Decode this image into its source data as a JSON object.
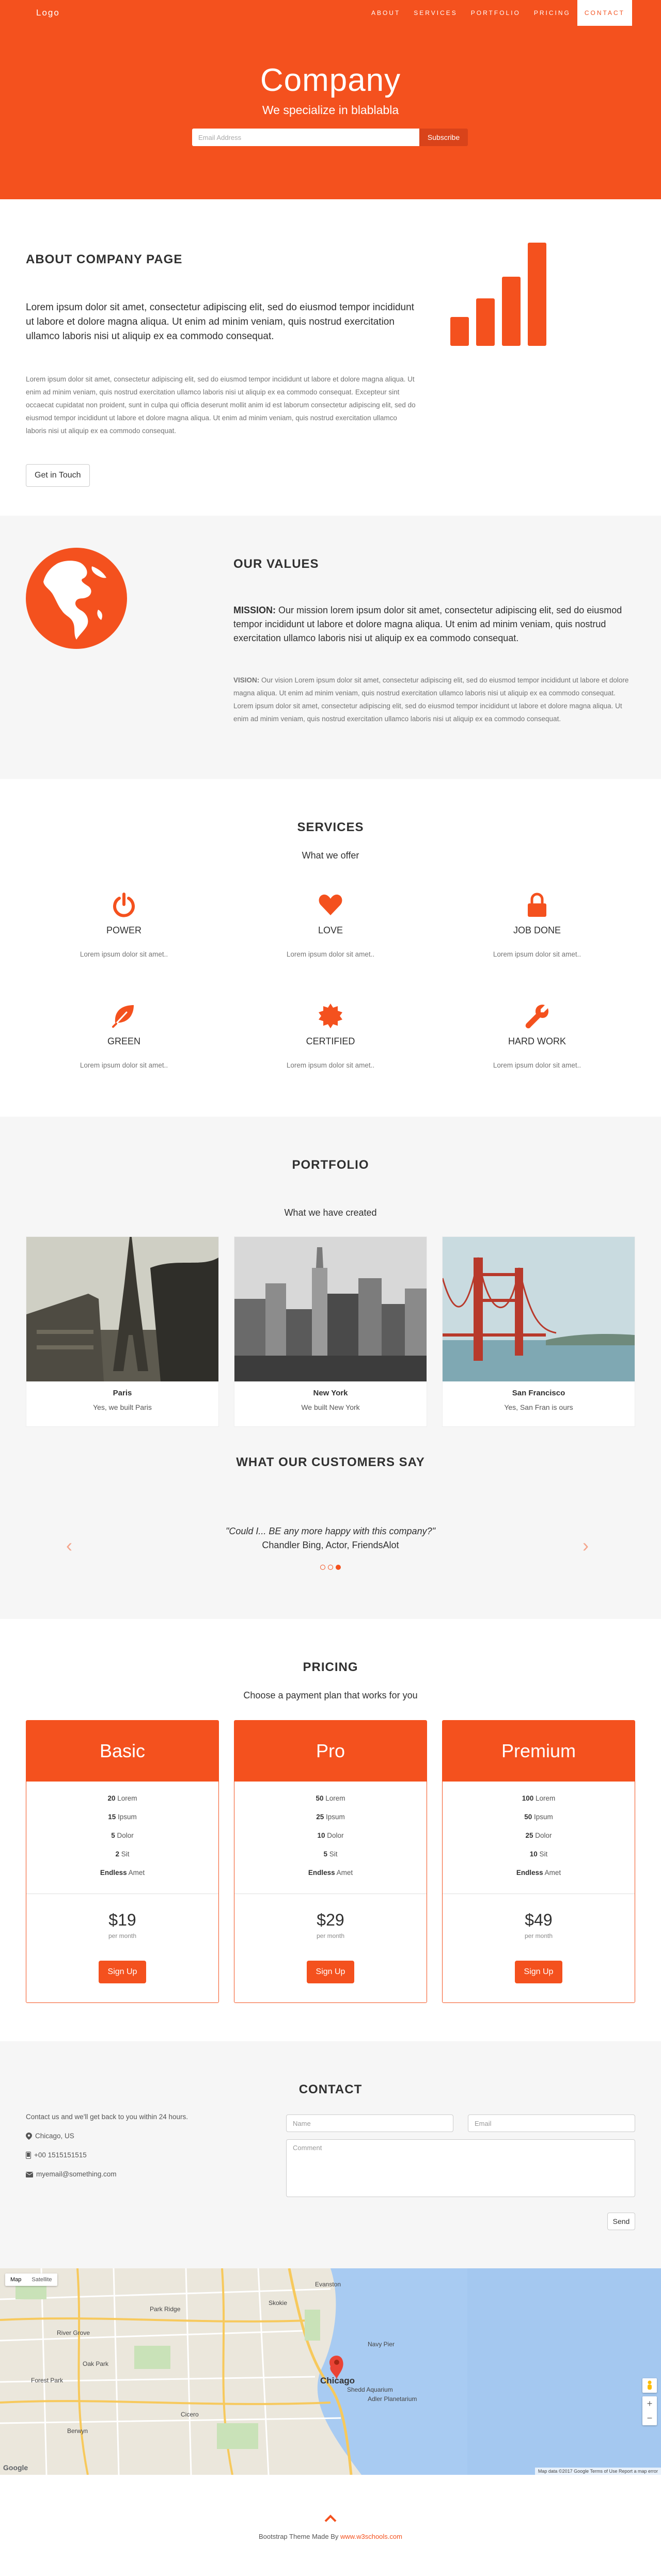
{
  "nav": {
    "logo": "Logo",
    "links": [
      "ABOUT",
      "SERVICES",
      "PORTFOLIO",
      "PRICING",
      "CONTACT"
    ]
  },
  "hero": {
    "title": "Company",
    "subtitle": "We specialize in blablabla",
    "email_placeholder": "Email Address",
    "subscribe_label": "Subscribe"
  },
  "about": {
    "title": "ABOUT COMPANY PAGE",
    "lead": "Lorem ipsum dolor sit amet, consectetur adipiscing elit, sed do eiusmod tempor incididunt ut labore et dolore magna aliqua. Ut enim ad minim veniam, quis nostrud exercitation ullamco laboris nisi ut aliquip ex ea commodo consequat.",
    "body": "Lorem ipsum dolor sit amet, consectetur adipiscing elit, sed do eiusmod tempor incididunt ut labore et dolore magna aliqua. Ut enim ad minim veniam, quis nostrud exercitation ullamco laboris nisi ut aliquip ex ea commodo consequat. Excepteur sint occaecat cupidatat non proident, sunt in culpa qui officia deserunt mollit anim id est laborum consectetur adipiscing elit, sed do eiusmod tempor incididunt ut labore et dolore magna aliqua. Ut enim ad minim veniam, quis nostrud exercitation ullamco laboris nisi ut aliquip ex ea commodo consequat.",
    "button": "Get in Touch",
    "icon": "signal-icon"
  },
  "values": {
    "title": "OUR VALUES",
    "mission_label": "MISSION:",
    "mission": " Our mission lorem ipsum dolor sit amet, consectetur adipiscing elit, sed do eiusmod tempor incididunt ut labore et dolore magna aliqua. Ut enim ad minim veniam, quis nostrud exercitation ullamco laboris nisi ut aliquip ex ea commodo consequat.",
    "vision_label": "VISION:",
    "vision": " Our vision Lorem ipsum dolor sit amet, consectetur adipiscing elit, sed do eiusmod tempor incididunt ut labore et dolore magna aliqua. Ut enim ad minim veniam, quis nostrud exercitation ullamco laboris nisi ut aliquip ex ea commodo consequat. Lorem ipsum dolor sit amet, consectetur adipiscing elit, sed do eiusmod tempor incididunt ut labore et dolore magna aliqua. Ut enim ad minim veniam, quis nostrud exercitation ullamco laboris nisi ut aliquip ex ea commodo consequat.",
    "icon": "globe-icon"
  },
  "services": {
    "title": "SERVICES",
    "subtitle": "What we offer",
    "items": [
      {
        "icon": "power-icon",
        "title": "POWER",
        "text": "Lorem ipsum dolor sit amet.."
      },
      {
        "icon": "heart-icon",
        "title": "LOVE",
        "text": "Lorem ipsum dolor sit amet.."
      },
      {
        "icon": "lock-icon",
        "title": "JOB DONE",
        "text": "Lorem ipsum dolor sit amet.."
      },
      {
        "icon": "leaf-icon",
        "title": "GREEN",
        "text": "Lorem ipsum dolor sit amet.."
      },
      {
        "icon": "certificate-icon",
        "title": "CERTIFIED",
        "text": "Lorem ipsum dolor sit amet.."
      },
      {
        "icon": "wrench-icon",
        "title": "HARD WORK",
        "text": "Lorem ipsum dolor sit amet.."
      }
    ]
  },
  "portfolio": {
    "title": "PORTFOLIO",
    "subtitle": "What we have created",
    "items": [
      {
        "city": "Paris",
        "caption": "Yes, we built Paris"
      },
      {
        "city": "New York",
        "caption": "We built New York"
      },
      {
        "city": "San Francisco",
        "caption": "Yes, San Fran is ours"
      }
    ]
  },
  "testimonials": {
    "title": "WHAT OUR CUSTOMERS SAY",
    "quote": "\"Could I... BE any more happy with this company?\"",
    "author": "Chandler Bing, Actor, FriendsAlot",
    "prev_icon": "chevron-left-icon",
    "next_icon": "chevron-right-icon",
    "slides": 3,
    "active_slide": 3
  },
  "pricing": {
    "title": "PRICING",
    "subtitle": "Choose a payment plan that works for you",
    "plans": [
      {
        "name": "Basic",
        "rows": [
          [
            "20",
            " Lorem"
          ],
          [
            "15",
            " Ipsum"
          ],
          [
            "5",
            " Dolor"
          ],
          [
            "2",
            " Sit"
          ],
          [
            "Endless",
            " Amet"
          ]
        ],
        "price": "$19",
        "per": "per month",
        "button": "Sign Up"
      },
      {
        "name": "Pro",
        "rows": [
          [
            "50",
            " Lorem"
          ],
          [
            "25",
            " Ipsum"
          ],
          [
            "10",
            " Dolor"
          ],
          [
            "5",
            " Sit"
          ],
          [
            "Endless",
            " Amet"
          ]
        ],
        "price": "$29",
        "per": "per month",
        "button": "Sign Up"
      },
      {
        "name": "Premium",
        "rows": [
          [
            "100",
            " Lorem"
          ],
          [
            "50",
            " Ipsum"
          ],
          [
            "25",
            " Dolor"
          ],
          [
            "10",
            " Sit"
          ],
          [
            "Endless",
            " Amet"
          ]
        ],
        "price": "$49",
        "per": "per month",
        "button": "Sign Up"
      }
    ]
  },
  "contact": {
    "title": "CONTACT",
    "intro": "Contact us and we'll get back to you within 24 hours.",
    "location": "Chicago, US",
    "phone": "+00 1515151515",
    "email": "myemail@something.com",
    "name_placeholder": "Name",
    "email_placeholder": "Email",
    "comment_placeholder": "Comment",
    "send_label": "Send"
  },
  "map": {
    "type_map": "Map",
    "type_satellite": "Satellite",
    "city_label": "Chicago",
    "labels": [
      "Evanston",
      "Skokie",
      "Park Ridge",
      "River Grove",
      "Oak Park",
      "Cicero",
      "Berwyn",
      "Forest Park",
      "Navy Pier",
      "Shedd Aquarium",
      "Adler Planetarium"
    ],
    "attribution": "Google",
    "terms": "Map data ©2017 Google   Terms of Use   Report a map error"
  },
  "footer": {
    "text": "Bootstrap Theme Made By ",
    "link": "www.w3schools.com",
    "up_icon": "chevron-up-icon"
  },
  "colors": {
    "accent": "#f4511e",
    "section_grey": "#f6f6f6",
    "text_dark": "#303030",
    "text_muted": "#757575"
  }
}
